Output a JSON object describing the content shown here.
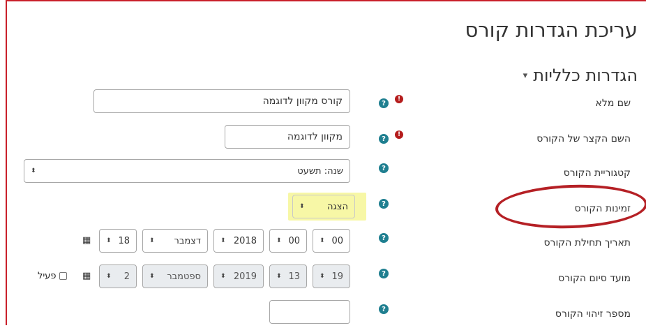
{
  "page": {
    "title": "עריכת הגדרות קורס",
    "section_caret": "▾",
    "section_title": "הגדרות כלליות"
  },
  "fields": {
    "fullname": {
      "label": "שם מלא",
      "value": "קורס מקוון לדוגמה"
    },
    "shortname": {
      "label": "השם הקצר של הקורס",
      "value": "מקוון לדוגמה"
    },
    "category": {
      "label": "קטגוריית הקורס",
      "value": "שנה: תשעט"
    },
    "visibility": {
      "label": "זמינות הקורס",
      "value": "הצגה"
    },
    "startdate": {
      "label": "תאריך תחילת הקורס",
      "day": "18",
      "month": "דצמבר",
      "year": "2018",
      "hour": "00",
      "minute": "00"
    },
    "enddate": {
      "label": "מועד סיום הקורס",
      "day": "2",
      "month": "ספטמבר",
      "year": "2019",
      "hour": "13",
      "minute": "19",
      "enable_label": "פעיל"
    },
    "idnumber": {
      "label": "מספר זיהוי הקורס",
      "value": ""
    }
  },
  "icons": {
    "help_glyph": "?",
    "required_glyph": "!",
    "select_arrows": "⬍",
    "calendar_glyph": "▦"
  },
  "colors": {
    "help": "#1f7f90",
    "required": "#b51d1d",
    "annotation_oval": "#b52025",
    "highlight": "#f7f7a6",
    "frame": "#c9202a"
  }
}
